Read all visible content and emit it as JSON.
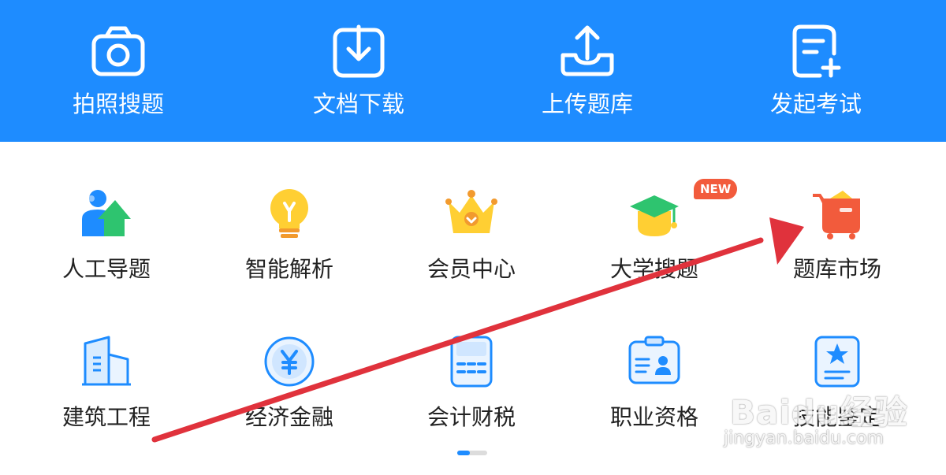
{
  "top_bar": {
    "items": [
      {
        "label": "拍照搜题",
        "icon": "camera-icon"
      },
      {
        "label": "文档下载",
        "icon": "download-icon"
      },
      {
        "label": "上传题库",
        "icon": "upload-icon"
      },
      {
        "label": "发起考试",
        "icon": "add-document-icon"
      }
    ],
    "color": "#1e8cff"
  },
  "grid": {
    "row1": [
      {
        "label": "人工导题",
        "icon": "person-upload-icon"
      },
      {
        "label": "智能解析",
        "icon": "lightbulb-icon"
      },
      {
        "label": "会员中心",
        "icon": "crown-icon"
      },
      {
        "label": "大学搜题",
        "icon": "graduation-cap-icon",
        "badge": "NEW"
      },
      {
        "label": "题库市场",
        "icon": "shopping-cart-icon"
      }
    ],
    "row2": [
      {
        "label": "建筑工程",
        "icon": "building-icon"
      },
      {
        "label": "经济金融",
        "icon": "yuan-coin-icon"
      },
      {
        "label": "会计财税",
        "icon": "calculator-icon"
      },
      {
        "label": "职业资格",
        "icon": "id-card-icon"
      },
      {
        "label": "技能鉴定",
        "icon": "certificate-icon"
      }
    ]
  },
  "annotation": {
    "color": "#e0323c"
  },
  "watermark": {
    "logo": "Baidu经验",
    "url": "jingyan.baidu.com"
  }
}
